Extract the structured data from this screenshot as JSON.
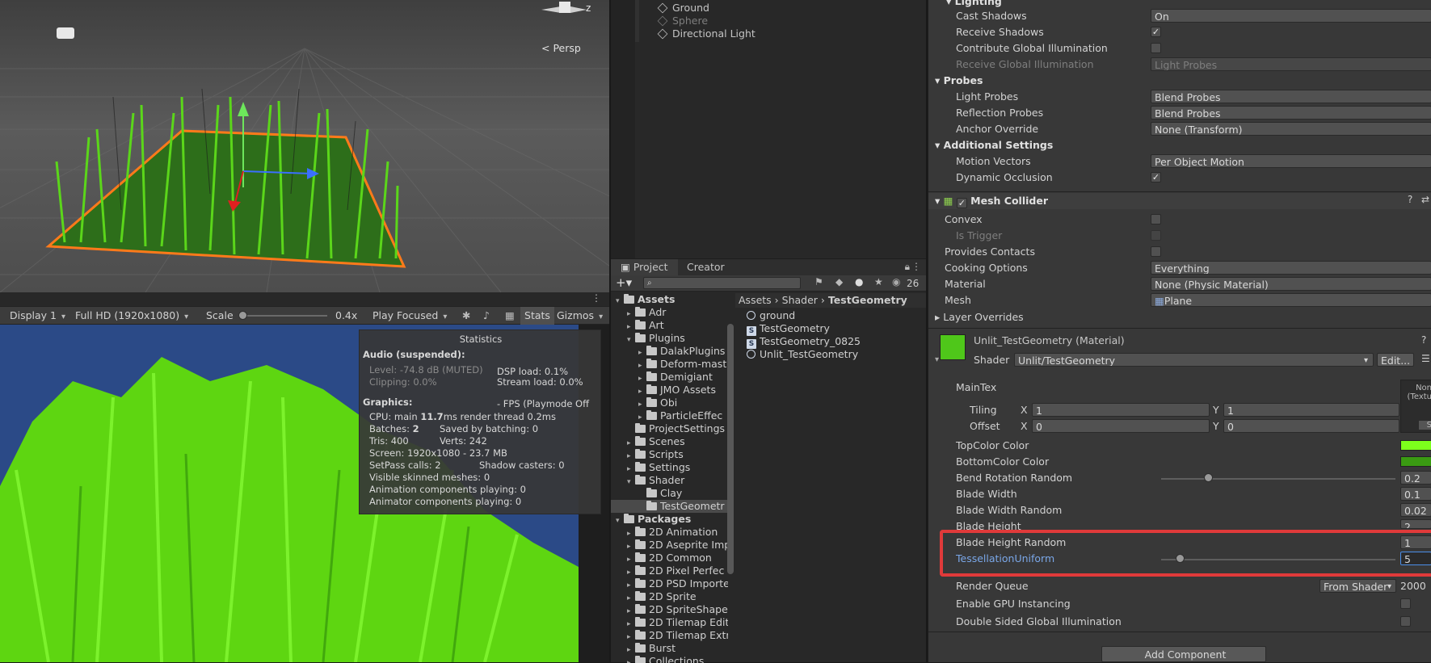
{
  "scene": {
    "persp_label": "Persp",
    "axis_z": "z"
  },
  "game_toolbar": {
    "display": "Display 1",
    "resolution": "Full HD (1920x1080)",
    "scale_label": "Scale",
    "scale_value": "0.4x",
    "play_mode": "Play Focused",
    "stats": "Stats",
    "gizmos": "Gizmos"
  },
  "stats": {
    "title": "Statistics",
    "audio_header": "Audio (suspended):",
    "level": "Level: -74.8 dB (MUTED)",
    "clipping": "Clipping: 0.0%",
    "dsp": "DSP load: 0.1%",
    "stream": "Stream load: 0.0%",
    "graphics_header": "Graphics:",
    "fps": "- FPS (Playmode Off",
    "cpu_a": "CPU: main ",
    "cpu_b": "11.7",
    "cpu_c": "ms  render thread 0.2ms",
    "batches_a": "Batches: ",
    "batches_b": "2",
    "saved": "Saved by batching: 0",
    "tris": "Tris: 400",
    "verts": "Verts: 242",
    "screen": "Screen: 1920x1080 - 23.7 MB",
    "setpass": "SetPass calls: 2",
    "shadow": "Shadow casters: 0",
    "skinned": "Visible skinned meshes: 0",
    "anim": "Animation components playing: 0",
    "animator": "Animator components playing: 0"
  },
  "hierarchy": {
    "items": [
      "Ground",
      "Sphere",
      "Directional Light"
    ]
  },
  "project": {
    "tabs": [
      "Project",
      "Creator"
    ],
    "count": "26",
    "breadcrumb": [
      "Assets",
      "Shader",
      "TestGeometry"
    ],
    "tree": [
      {
        "label": "Assets",
        "level": 0,
        "open": true,
        "bold": true
      },
      {
        "label": "Adr",
        "level": 1
      },
      {
        "label": "Art",
        "level": 1
      },
      {
        "label": "Plugins",
        "level": 1,
        "open": true
      },
      {
        "label": "DalakPlugins",
        "level": 2
      },
      {
        "label": "Deform-mast",
        "level": 2
      },
      {
        "label": "Demigiant",
        "level": 2
      },
      {
        "label": "JMO Assets",
        "level": 2
      },
      {
        "label": "Obi",
        "level": 2
      },
      {
        "label": "ParticleEffec",
        "level": 2
      },
      {
        "label": "ProjectSettings",
        "level": 1,
        "noarrow": true
      },
      {
        "label": "Scenes",
        "level": 1
      },
      {
        "label": "Scripts",
        "level": 1
      },
      {
        "label": "Settings",
        "level": 1
      },
      {
        "label": "Shader",
        "level": 1,
        "open": true
      },
      {
        "label": "Clay",
        "level": 2,
        "noarrow": true
      },
      {
        "label": "TestGeometr",
        "level": 2,
        "noarrow": true,
        "selected": true
      },
      {
        "label": "Packages",
        "level": 0,
        "open": true,
        "bold": true
      },
      {
        "label": "2D Animation",
        "level": 1
      },
      {
        "label": "2D Aseprite Imp",
        "level": 1
      },
      {
        "label": "2D Common",
        "level": 1
      },
      {
        "label": "2D Pixel Perfec",
        "level": 1
      },
      {
        "label": "2D PSD Importe",
        "level": 1
      },
      {
        "label": "2D Sprite",
        "level": 1
      },
      {
        "label": "2D SpriteShape",
        "level": 1
      },
      {
        "label": "2D Tilemap Edit",
        "level": 1
      },
      {
        "label": "2D Tilemap Extr",
        "level": 1
      },
      {
        "label": "Burst",
        "level": 1
      },
      {
        "label": "Collections",
        "level": 1
      }
    ],
    "files": [
      {
        "label": "ground",
        "icon": "circle"
      },
      {
        "label": "TestGeometry",
        "icon": "shader"
      },
      {
        "label": "TestGeometry_0825",
        "icon": "shader"
      },
      {
        "label": "Unlit_TestGeometry",
        "icon": "circle"
      }
    ]
  },
  "inspector": {
    "lighting": "Lighting",
    "cast_shadows": "Cast Shadows",
    "cast_shadows_val": "On",
    "receive_shadows": "Receive Shadows",
    "contribute_gi": "Contribute Global Illumination",
    "receive_gi": "Receive Global Illumination",
    "receive_gi_val": "Light Probes",
    "probes": "Probes",
    "light_probes": "Light Probes",
    "light_probes_val": "Blend Probes",
    "reflection_probes": "Reflection Probes",
    "reflection_probes_val": "Blend Probes",
    "anchor": "Anchor Override",
    "anchor_val": "None (Transform)",
    "additional": "Additional Settings",
    "motion": "Motion Vectors",
    "motion_val": "Per Object Motion",
    "dynamic_occ": "Dynamic Occlusion",
    "mesh_collider": "Mesh Collider",
    "convex": "Convex",
    "is_trigger": "Is Trigger",
    "provides_contacts": "Provides Contacts",
    "cooking": "Cooking Options",
    "cooking_val": "Everything",
    "material": "Material",
    "material_val": "None (Physic Material)",
    "mesh": "Mesh",
    "mesh_val": "Plane",
    "layer_overrides": "Layer Overrides",
    "mat_name": "Unlit_TestGeometry (Material)",
    "shader_label": "Shader",
    "shader_val": "Unlit/TestGeometry",
    "edit": "Edit...",
    "maintex": "MainTex",
    "tex_none": "Non",
    "tex_texture": "(Textu",
    "tex_select": "S",
    "tiling": "Tiling",
    "offset": "Offset",
    "x": "X",
    "y": "Y",
    "tiling_x": "1",
    "tiling_y": "1",
    "offset_x": "0",
    "offset_y": "0",
    "top_color": "TopColor Color",
    "bottom_color": "BottomColor Color",
    "bend": "Bend Rotation Random",
    "bend_val": "0.2",
    "bend_frac": 0.2,
    "blade_width": "Blade Width",
    "blade_width_val": "0.1",
    "blade_width_rand": "Blade Width Random",
    "blade_width_rand_val": "0.02",
    "blade_height": "Blade Height",
    "blade_height_val": "2",
    "blade_height_rand": "Blade Height Random",
    "blade_height_rand_val": "1",
    "tess": "TessellationUniform",
    "tess_val": "5",
    "tess_frac": 0.08,
    "render_queue": "Render Queue",
    "render_queue_mode": "From Shader",
    "render_queue_val": "2000",
    "gpu_inst": "Enable GPU Instancing",
    "double_gi": "Double Sided Global Illumination",
    "add_component": "Add Component",
    "colors": {
      "top": "#7dff1c",
      "bottom": "#3a9a12",
      "highlight": "#e03a3a",
      "link": "#7aa7e8"
    }
  }
}
